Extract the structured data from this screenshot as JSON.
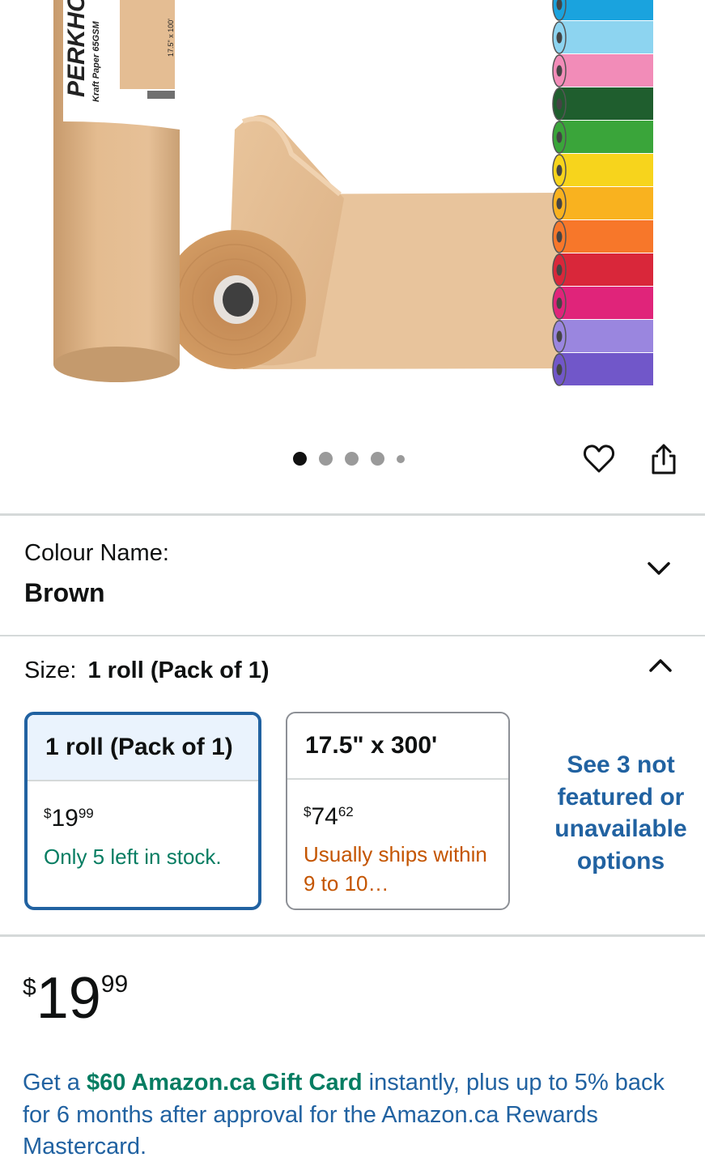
{
  "product_image": {
    "label_brand": "PERKHO",
    "label_sub": "Kraft Paper 65GSM",
    "label_size": "17.5\" x 100'",
    "swatch_colors": [
      "#1aa3de",
      "#8dd4f0",
      "#f28cb8",
      "#1f5e2e",
      "#3aa53a",
      "#f7d41c",
      "#f9b21f",
      "#f7772a",
      "#d9273a",
      "#e0247a",
      "#9a86df",
      "#7157c9"
    ]
  },
  "carousel": {
    "count": 5,
    "active_index": 0
  },
  "actions": {
    "wishlist_icon": "heart-icon",
    "share_icon": "share-icon"
  },
  "colour": {
    "label": "Colour Name:",
    "value": "Brown"
  },
  "size": {
    "label": "Size:",
    "value": "1 roll (Pack of 1)",
    "options": [
      {
        "title": "1 roll (Pack of 1)",
        "currency": "$",
        "whole": "19",
        "fraction": "99",
        "availability": "Only 5 left in stock.",
        "selected": true
      },
      {
        "title": "17.5\" x 300'",
        "currency": "$",
        "whole": "74",
        "fraction": "62",
        "availability": "Usually ships within 9 to 10…",
        "selected": false
      }
    ],
    "see_more": "See 3 not featured or unavailable options"
  },
  "price": {
    "currency": "$",
    "whole": "19",
    "fraction": "99"
  },
  "promo": {
    "prefix": "Get a ",
    "highlight": "$60 Amazon.ca Gift Card",
    "suffix": " instantly, plus up to 5% back for 6 months after approval for the Amazon.ca Rewards Mastercard."
  },
  "colors": {
    "link": "#2162a1",
    "green": "#067d62",
    "orange": "#c45500",
    "selected_border": "#2162a1"
  }
}
